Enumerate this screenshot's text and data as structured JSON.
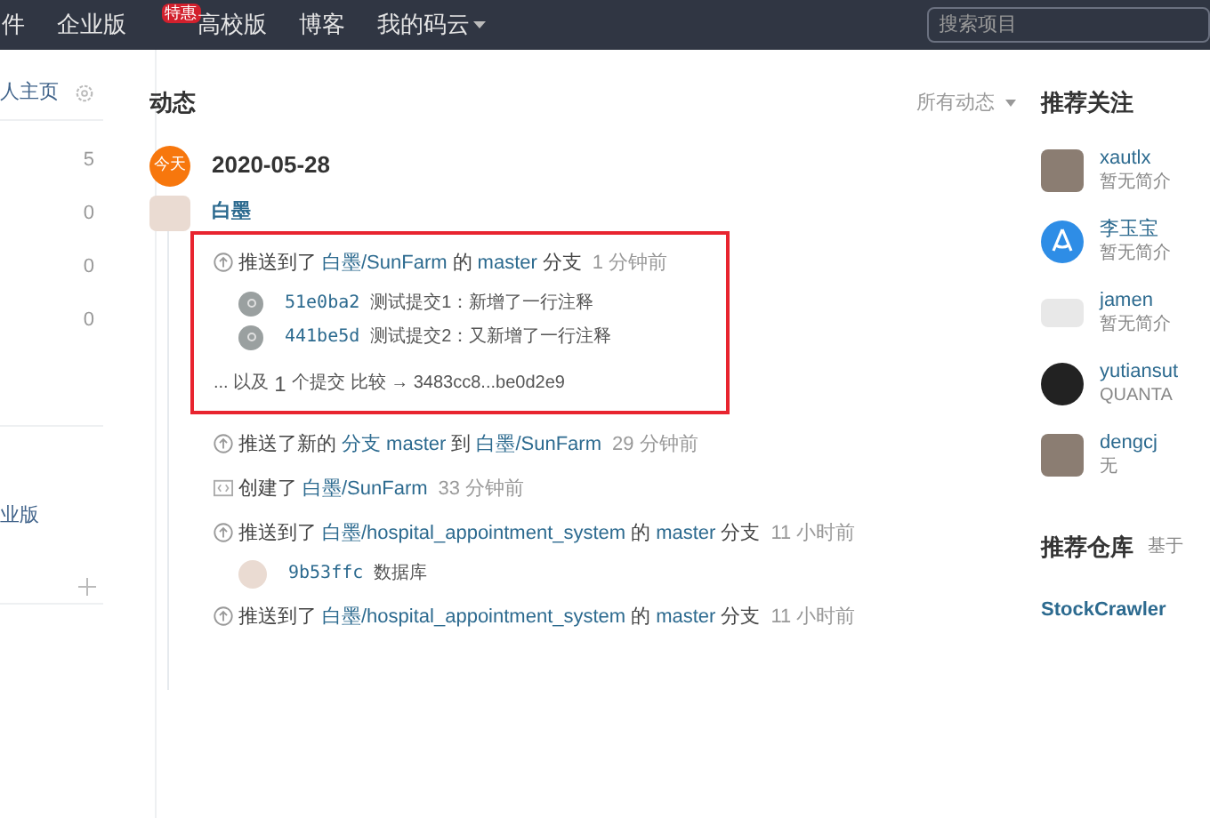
{
  "nav": {
    "items": [
      {
        "label": "件"
      },
      {
        "label": "企业版",
        "badge": "特惠"
      },
      {
        "label": "高校版"
      },
      {
        "label": "博客"
      },
      {
        "label": "我的码云",
        "dropdown": true
      }
    ],
    "search": {
      "placeholder": "搜索项目"
    }
  },
  "sidebar": {
    "header": "人主页",
    "counts": [
      "5",
      "0",
      "0",
      "0"
    ],
    "link": "业版"
  },
  "feed": {
    "title": "动态",
    "filter": "所有动态",
    "date_badge": "今天",
    "date": "2020-05-28",
    "user": "白墨",
    "events": [
      {
        "kind": "push",
        "highlighted": true,
        "parts": [
          {
            "text": "推送到了",
            "link": false
          },
          {
            "text": "白墨/SunFarm",
            "link": true
          },
          {
            "text": "的",
            "link": false
          },
          {
            "text": "master",
            "link": true
          },
          {
            "text": "分支",
            "link": false
          }
        ],
        "time": "1 分钟前",
        "commits": [
          {
            "kind": "default",
            "sha": "51e0ba2",
            "message": "测试提交1：新增了一行注释"
          },
          {
            "kind": "default",
            "sha": "441be5d",
            "message": "测试提交2：又新增了一行注释"
          }
        ],
        "more": {
          "prefix": "... 以及",
          "count": "1",
          "suffix": "个提交",
          "compare": "比较 → 3483cc8...be0d2e9"
        }
      },
      {
        "kind": "push",
        "highlighted": false,
        "parts": [
          {
            "text": "推送了新的",
            "link": false
          },
          {
            "text": "分支 master",
            "link": true
          },
          {
            "text": "到",
            "link": false
          },
          {
            "text": "白墨/SunFarm",
            "link": true
          }
        ],
        "time": "29 分钟前"
      },
      {
        "kind": "create",
        "highlighted": false,
        "parts": [
          {
            "text": "创建了",
            "link": false
          },
          {
            "text": "白墨/SunFarm",
            "link": true
          }
        ],
        "time": "33 分钟前"
      },
      {
        "kind": "push",
        "highlighted": false,
        "parts": [
          {
            "text": "推送到了",
            "link": false
          },
          {
            "text": "白墨/hospital_appointment_system",
            "link": true
          },
          {
            "text": "的",
            "link": false
          },
          {
            "text": "master",
            "link": true
          },
          {
            "text": "分支",
            "link": false
          }
        ],
        "time": "11 小时前",
        "commits": [
          {
            "kind": "user",
            "sha": "9b53ffc",
            "message": "数据库"
          }
        ]
      },
      {
        "kind": "push",
        "highlighted": false,
        "parts": [
          {
            "text": "推送到了",
            "link": false
          },
          {
            "text": "白墨/hospital_appointment_system",
            "link": true
          },
          {
            "text": "的",
            "link": false
          },
          {
            "text": "master",
            "link": true
          },
          {
            "text": "分支",
            "link": false
          }
        ],
        "time": "11 小时前"
      }
    ]
  },
  "recommend": {
    "title": "推荐关注",
    "people": [
      {
        "kind": "photo",
        "name": "xautlx",
        "bio": "暂无简介"
      },
      {
        "kind": "logo",
        "name": "李玉宝",
        "bio": "暂无简介"
      },
      {
        "kind": "script",
        "name": "jamen",
        "bio": "暂无简介"
      },
      {
        "kind": "dark",
        "name": "yutiansut",
        "bio": "QUANTA"
      },
      {
        "kind": "photo",
        "name": "dengcj",
        "bio": "无"
      }
    ],
    "repos_title": "推荐仓库",
    "repos_note": "基于",
    "repos": [
      "StockCrawler"
    ]
  }
}
